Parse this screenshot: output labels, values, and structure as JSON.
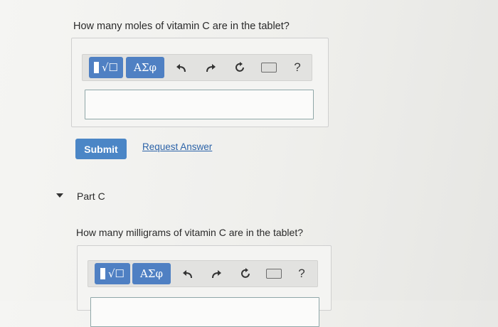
{
  "part_b": {
    "question": "How many moles of vitamin C are in the tablet?",
    "toolbar": {
      "templates_label": "√☐",
      "greek_label": "ΑΣφ",
      "undo_icon": "undo-icon",
      "redo_icon": "redo-icon",
      "reset_icon": "reset-icon",
      "keyboard_icon": "keyboard-icon",
      "help_label": "?"
    },
    "answer_value": "",
    "submit_label": "Submit",
    "request_answer_label": "Request Answer"
  },
  "part_c": {
    "label": "Part C",
    "question": "How many milligrams of vitamin C are in the tablet?",
    "toolbar": {
      "templates_label": "√☐",
      "greek_label": "ΑΣφ",
      "help_label": "?"
    }
  }
}
